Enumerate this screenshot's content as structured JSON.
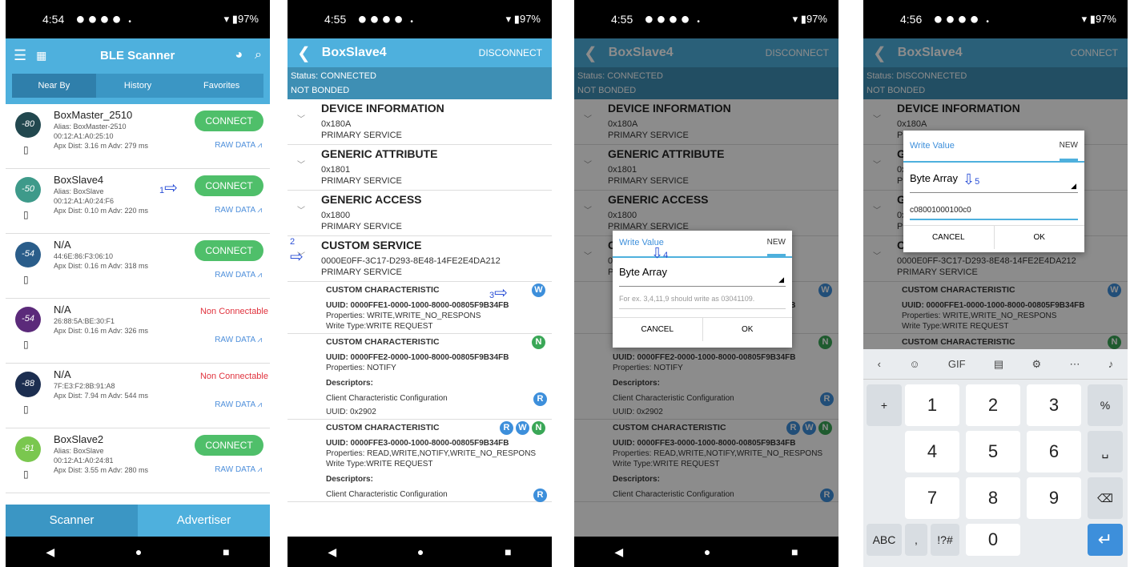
{
  "screens": [
    {
      "time": "4:54",
      "battery": "97%",
      "title": "BLE Scanner",
      "tabs": [
        "Near By",
        "History",
        "Favorites"
      ],
      "devices": [
        {
          "name": "BoxMaster_2510",
          "alias": "Alias: BoxMaster-2510",
          "mac": "00:12:A1:A0:25:10",
          "dist": "Apx Dist: 3.16 m   Adv: 279 ms",
          "rssi": "-80",
          "color": "#22484f",
          "action": "CONNECT",
          "raw": "RAW DATA"
        },
        {
          "name": "BoxSlave4",
          "alias": "Alias: BoxSlave",
          "mac": "00:12:A1:A0:24:F6",
          "dist": "Apx Dist: 0.10 m   Adv: 220 ms",
          "rssi": "-50",
          "color": "#3e9a8a",
          "action": "CONNECT",
          "raw": "RAW DATA"
        },
        {
          "name": "N/A",
          "alias": "",
          "mac": "44:6E:86:F3:06:10",
          "dist": "Apx Dist: 0.16 m   Adv: 318 ms",
          "rssi": "-54",
          "color": "#2a5d8a",
          "action": "CONNECT",
          "raw": "RAW DATA"
        },
        {
          "name": "N/A",
          "alias": "",
          "mac": "26:88:5A:BE:30:F1",
          "dist": "Apx Dist: 0.16 m   Adv: 326 ms",
          "rssi": "-54",
          "color": "#5b2a7a",
          "action": "Non Connectable",
          "raw": "RAW DATA"
        },
        {
          "name": "N/A",
          "alias": "",
          "mac": "7F:E3:F2:8B:91:A8",
          "dist": "Apx Dist: 7.94 m   Adv: 544 ms",
          "rssi": "-88",
          "color": "#1c2e50",
          "action": "Non Connectable",
          "raw": "RAW DATA"
        },
        {
          "name": "BoxSlave2",
          "alias": "Alias: BoxSlave",
          "mac": "00:12:A1:A0:24:81",
          "dist": "Apx Dist: 3.55 m   Adv: 280 ms",
          "rssi": "-81",
          "color": "#7ac74f",
          "action": "CONNECT",
          "raw": "RAW DATA"
        }
      ],
      "bottom_tabs": [
        "Scanner",
        "Advertiser"
      ],
      "annotation": "1"
    },
    {
      "time": "4:55",
      "battery": "97%",
      "title": "BoxSlave4",
      "action": "DISCONNECT",
      "status": "Status: CONNECTED",
      "bonded": "NOT BONDED",
      "services": [
        {
          "name": "DEVICE INFORMATION",
          "uuid": "0x180A",
          "type": "PRIMARY SERVICE"
        },
        {
          "name": "GENERIC ATTRIBUTE",
          "uuid": "0x1801",
          "type": "PRIMARY SERVICE"
        },
        {
          "name": "GENERIC ACCESS",
          "uuid": "0x1800",
          "type": "PRIMARY SERVICE"
        },
        {
          "name": "CUSTOM SERVICE",
          "uuid": "0000E0FF-3C17-D293-8E48-14FE2E4DA212",
          "type": "PRIMARY SERVICE"
        }
      ],
      "chars": [
        {
          "name": "CUSTOM CHARACTERISTIC",
          "uuid": "UUID: 0000FFE1-0000-1000-8000-00805F9B34FB",
          "props": "Properties: WRITE,WRITE_NO_RESPONS",
          "wt": "Write Type:WRITE REQUEST"
        },
        {
          "name": "CUSTOM CHARACTERISTIC",
          "uuid": "UUID: 0000FFE2-0000-1000-8000-00805F9B34FB",
          "props": "Properties: NOTIFY",
          "desc": "Descriptors:",
          "ccc": "Client Characteristic Configuration",
          "ccc_uuid": "UUID: 0x2902"
        },
        {
          "name": "CUSTOM CHARACTERISTIC",
          "uuid": "UUID: 0000FFE3-0000-1000-8000-00805F9B34FB",
          "props": "Properties: READ,WRITE,NOTIFY,WRITE_NO_RESPONS",
          "wt": "Write Type:WRITE REQUEST",
          "desc": "Descriptors:",
          "ccc": "Client Characteristic Configuration"
        }
      ],
      "annotations": [
        "2",
        "3"
      ]
    },
    {
      "time": "4:55",
      "battery": "97%",
      "dialog": {
        "title": "Write Value",
        "new": "NEW",
        "type": "Byte Array",
        "hint": "For ex. 3,4,11,9 should write as 03041109.",
        "cancel": "CANCEL",
        "ok": "OK"
      },
      "annotation": "4"
    },
    {
      "time": "4:56",
      "battery": "97%",
      "title": "BoxSlave4",
      "action": "CONNECT",
      "status": "Status: DISCONNECTED",
      "dialog": {
        "title": "Write Value",
        "new": "NEW",
        "type": "Byte Array",
        "value": "c08001000100c0",
        "cancel": "CANCEL",
        "ok": "OK"
      },
      "annotation": "5",
      "keys": {
        "row1": [
          "1",
          "2",
          "3"
        ],
        "row2": [
          "4",
          "5",
          "6"
        ],
        "row3": [
          "7",
          "8",
          "9"
        ],
        "zero": "0",
        "abc": "ABC",
        "sym": "!?#",
        "plus": "+",
        "pct": "%",
        "gif": "GIF"
      }
    }
  ]
}
